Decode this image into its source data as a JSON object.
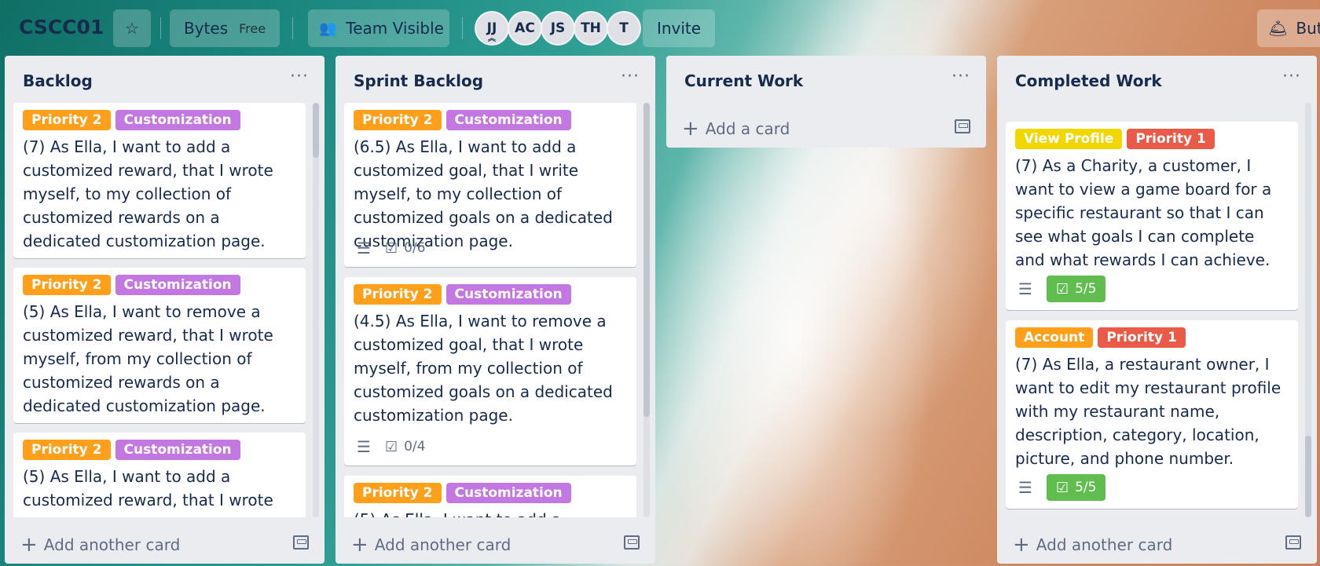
{
  "board": {
    "title": "CSCC01",
    "workspace": "Bytes",
    "workspace_plan": "Free",
    "visibility": "Team Visible",
    "invite_label": "Invite",
    "butler_label": "But",
    "members": [
      "JJ",
      "AC",
      "JS",
      "TH",
      "T"
    ]
  },
  "label_colors": {
    "orange": "#ff9f1a",
    "purple": "#c377e0",
    "red": "#eb5a46",
    "yellow": "#f2d600",
    "green": "#61bd4f"
  },
  "lists": [
    {
      "title": "Backlog",
      "add_label": "Add another card",
      "cards": [
        {
          "labels": [
            "Priority 2",
            "Customization"
          ],
          "text": "(7) As Ella, I want to add a customized reward, that I wrote myself, to my collection of customized rewards on a dedicated customization page."
        },
        {
          "labels": [
            "Priority 2",
            "Customization"
          ],
          "text": "(5) As Ella, I want to remove a customized reward, that I wrote myself, from my collection of customized rewards on a dedicated customization page."
        },
        {
          "labels": [
            "Priority 2",
            "Customization"
          ],
          "text": "(5) As Ella, I want to add a customized reward, that I wrote"
        }
      ]
    },
    {
      "title": "Sprint Backlog",
      "add_label": "Add another card",
      "cards": [
        {
          "labels": [
            "Priority 2",
            "Customization"
          ],
          "text": "(6.5) As Ella, I want to add a customized goal, that I write myself, to my collection of customized goals on a dedicated customization page.",
          "checklist": "0/6"
        },
        {
          "labels": [
            "Priority 2",
            "Customization"
          ],
          "text": "(4.5) As Ella, I want to remove a customized goal, that I wrote myself, from my collection of customized goals on a dedicated customization page.",
          "checklist": "0/4"
        },
        {
          "labels": [
            "Priority 2",
            "Customization"
          ],
          "text": "(5) As Ella, I want to add a"
        }
      ]
    },
    {
      "title": "Current Work",
      "add_label": "Add a card"
    },
    {
      "title": "Completed Work",
      "add_label": "Add another card",
      "cards": [
        {
          "labels": [
            "View Profile",
            "Priority 1"
          ],
          "text": "(7) As a Charity, a customer, I want to view a game board for a specific restaurant so that I can see what goals I can complete and what rewards I can achieve.",
          "checklist": "5/5"
        },
        {
          "labels": [
            "Account",
            "Priority 1"
          ],
          "text": "(7) As Ella, a restaurant owner, I want to edit my restaurant profile with my restaurant name, description, category, location, picture, and phone number.",
          "checklist": "5/5"
        }
      ]
    }
  ]
}
